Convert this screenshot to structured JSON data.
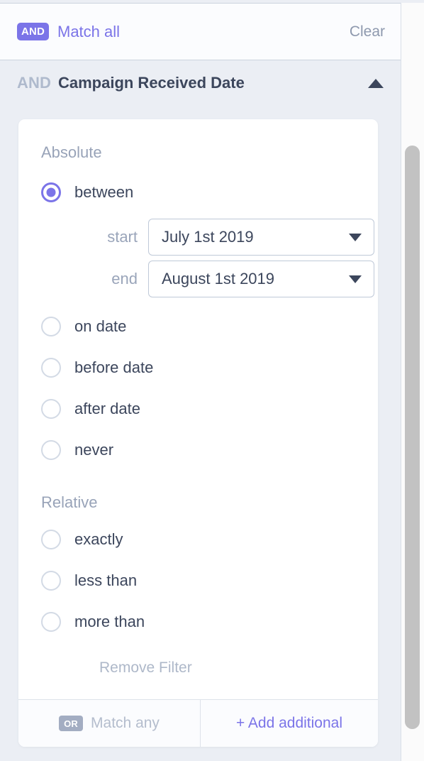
{
  "topbar": {
    "operator_badge": "AND",
    "match_label": "Match all",
    "clear_label": "Clear"
  },
  "filter_group": {
    "operator": "AND",
    "title": "Campaign Received Date",
    "collapse_icon": "triangle-up-icon"
  },
  "panel": {
    "absolute": {
      "section_label": "Absolute",
      "options": [
        {
          "label": "between",
          "selected": true
        },
        {
          "label": "on date",
          "selected": false
        },
        {
          "label": "before date",
          "selected": false
        },
        {
          "label": "after date",
          "selected": false
        },
        {
          "label": "never",
          "selected": false
        }
      ],
      "date_fields": [
        {
          "label": "start",
          "value": "July 1st 2019",
          "icon": "chevron-down-icon"
        },
        {
          "label": "end",
          "value": "August 1st 2019",
          "icon": "chevron-down-icon"
        }
      ]
    },
    "relative": {
      "section_label": "Relative",
      "options": [
        {
          "label": "exactly",
          "selected": false
        },
        {
          "label": "less than",
          "selected": false
        },
        {
          "label": "more than",
          "selected": false
        }
      ]
    },
    "remove_filter_label": "Remove Filter"
  },
  "footer": {
    "or_badge": "OR",
    "match_any_label": "Match any",
    "add_additional_label": "+ Add additional"
  },
  "colors": {
    "accent_purple": "#7b74e8",
    "background": "#ebeef4",
    "text_dark": "#3c465c",
    "text_muted": "#98a3b8",
    "badge_gray": "#a3adc2",
    "scrollbar_thumb": "#c2c2c2"
  }
}
